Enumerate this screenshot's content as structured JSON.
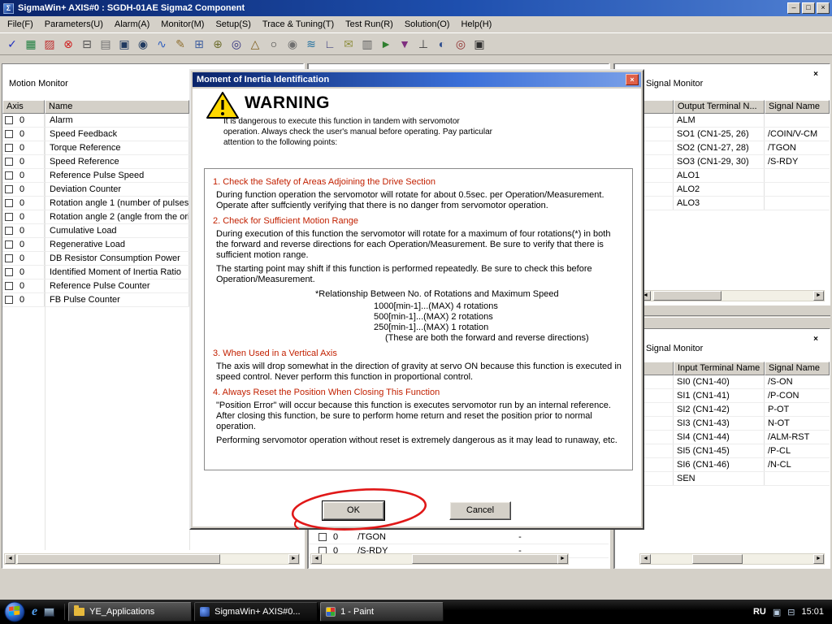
{
  "window": {
    "title": "SigmaWin+ AXIS#0 : SGDH-01AE Sigma2 Component",
    "app_icon_glyph": "Σ",
    "minimize_glyph": "–",
    "restore_glyph": "□",
    "close_glyph": "×"
  },
  "ui": {
    "arrow_left": "◄",
    "arrow_right": "►",
    "close_glyph": "×"
  },
  "colors": {
    "titlebar_blue": "#0a246a",
    "warning_heading_red": "#c22000",
    "annotation_red": "#e01818",
    "classic_gray": "#d4d0c8"
  },
  "menu": {
    "items": [
      {
        "label": "File(F)"
      },
      {
        "label": "Parameters(U)"
      },
      {
        "label": "Alarm(A)"
      },
      {
        "label": "Monitor(M)"
      },
      {
        "label": "Setup(S)"
      },
      {
        "label": "Trace & Tuning(T)"
      },
      {
        "label": "Test Run(R)"
      },
      {
        "label": "Solution(O)"
      },
      {
        "label": "Help(H)"
      }
    ]
  },
  "toolbar": {
    "icons": [
      {
        "name": "check-icon",
        "glyph": "✓",
        "color": "#1f2fbf"
      },
      {
        "name": "parameter-table-icon",
        "glyph": "▦",
        "color": "#1f7f3f"
      },
      {
        "name": "red-graph-icon",
        "glyph": "▨",
        "color": "#bf2f2f"
      },
      {
        "name": "alarm-circle-x-icon",
        "glyph": "⊗",
        "color": "#cf1f1f"
      },
      {
        "name": "printer-icon",
        "glyph": "⊟",
        "color": "#505050"
      },
      {
        "name": "document-icon",
        "glyph": "▤",
        "color": "#707070"
      },
      {
        "name": "monitor-icon",
        "glyph": "▣",
        "color": "#203a60"
      },
      {
        "name": "monitor-graph-icon",
        "glyph": "◉",
        "color": "#203a60"
      },
      {
        "name": "sine-wave-icon",
        "glyph": "∿",
        "color": "#2f5fbf"
      },
      {
        "name": "pencil-chart-icon",
        "glyph": "✎",
        "color": "#8f6f2f"
      },
      {
        "name": "window-grid-icon",
        "glyph": "⊞",
        "color": "#3f5f9f"
      },
      {
        "name": "gears-icon",
        "glyph": "⊕",
        "color": "#6f6f2f"
      },
      {
        "name": "magnifier-graph-icon",
        "glyph": "◎",
        "color": "#2f2f7f"
      },
      {
        "name": "triangle-scale-icon",
        "glyph": "△",
        "color": "#7f5f1f"
      },
      {
        "name": "magnifier-icon",
        "glyph": "○",
        "color": "#404040"
      },
      {
        "name": "gear-icon",
        "glyph": "◉",
        "color": "#6f6f6f"
      },
      {
        "name": "waveform-icon",
        "glyph": "≋",
        "color": "#1f6f9f"
      },
      {
        "name": "xy-plot-icon",
        "glyph": "∟",
        "color": "#404080"
      },
      {
        "name": "envelope-icon",
        "glyph": "✉",
        "color": "#8f8f3f"
      },
      {
        "name": "notepad-icon",
        "glyph": "▥",
        "color": "#5f5f5f"
      },
      {
        "name": "test-run-icon",
        "glyph": "►",
        "color": "#2f7f2f"
      },
      {
        "name": "funnel-icon",
        "glyph": "▼",
        "color": "#7f2f7f"
      },
      {
        "name": "antenna-icon",
        "glyph": "⊥",
        "color": "#3f3f3f"
      },
      {
        "name": "search-chart-icon",
        "glyph": "◐",
        "color": "#2f4f8f"
      },
      {
        "name": "target-icon",
        "glyph": "◎",
        "color": "#8f2f2f"
      },
      {
        "name": "screen-icon",
        "glyph": "▣",
        "color": "#2f2f2f"
      }
    ]
  },
  "panels": {
    "motion": {
      "title": "Motion Monitor",
      "columns": {
        "axis": "Axis",
        "name": "Name"
      },
      "rows": [
        {
          "axis": "0",
          "name": "Alarm"
        },
        {
          "axis": "0",
          "name": "Speed Feedback"
        },
        {
          "axis": "0",
          "name": "Torque Reference"
        },
        {
          "axis": "0",
          "name": "Speed Reference"
        },
        {
          "axis": "0",
          "name": "Reference Pulse Speed"
        },
        {
          "axis": "0",
          "name": "Deviation Counter"
        },
        {
          "axis": "0",
          "name": "Rotation angle 1 (number of pulses"
        },
        {
          "axis": "0",
          "name": "Rotation angle 2 (angle from the ori"
        },
        {
          "axis": "0",
          "name": "Cumulative Load"
        },
        {
          "axis": "0",
          "name": "Regenerative Load"
        },
        {
          "axis": "0",
          "name": "DB Resistor Consumption Power"
        },
        {
          "axis": "0",
          "name": "Identified Moment of Inertia Ratio"
        },
        {
          "axis": "0",
          "name": "Reference Pulse Counter"
        },
        {
          "axis": "0",
          "name": "FB Pulse Counter"
        }
      ]
    },
    "output_signal": {
      "title": "Signal Monitor",
      "columns": {
        "terminal": "Output Terminal N...",
        "signal": "Signal Name"
      },
      "rows": [
        {
          "terminal": "ALM",
          "signal": ""
        },
        {
          "terminal": "SO1 (CN1-25, 26)",
          "signal": "/COIN/V-CM"
        },
        {
          "terminal": "SO2 (CN1-27, 28)",
          "signal": "/TGON"
        },
        {
          "terminal": "SO3 (CN1-29, 30)",
          "signal": "/S-RDY"
        },
        {
          "terminal": "ALO1",
          "signal": ""
        },
        {
          "terminal": "ALO2",
          "signal": ""
        },
        {
          "terminal": "ALO3",
          "signal": ""
        }
      ]
    },
    "input_signal": {
      "title": "Signal Monitor",
      "columns": {
        "terminal": "Input Terminal Name",
        "signal": "Signal Name"
      },
      "rows": [
        {
          "terminal": "SI0 (CN1-40)",
          "signal": "/S-ON"
        },
        {
          "terminal": "SI1 (CN1-41)",
          "signal": "/P-CON"
        },
        {
          "terminal": "SI2 (CN1-42)",
          "signal": "P-OT"
        },
        {
          "terminal": "SI3 (CN1-43)",
          "signal": "N-OT"
        },
        {
          "terminal": "SI4 (CN1-44)",
          "signal": "/ALM-RST"
        },
        {
          "terminal": "SI5 (CN1-45)",
          "signal": "/P-CL"
        },
        {
          "terminal": "SI6 (CN1-46)",
          "signal": "/N-CL"
        },
        {
          "terminal": "SEN",
          "signal": ""
        }
      ]
    },
    "hidden_monitor": {
      "rows": [
        {
          "axis": "0",
          "name": "/TGON",
          "value": "-"
        },
        {
          "axis": "0",
          "name": "/S-RDY",
          "value": "-"
        }
      ]
    }
  },
  "dialog": {
    "title": "Moment of Inertia Identification",
    "close_glyph": "×",
    "warning_title": "WARNING",
    "intro": "It is dangerous to execute this function in tandem with servomotor operation. Always check the user's manual before operating. Pay particular attention to the following points:",
    "sections": [
      {
        "heading": "1. Check the Safety of Areas Adjoining the Drive Section",
        "paragraphs": [
          "During function operation the servomotor will rotate for about 0.5sec. per Operation/Measurement. Operate after suffciently verifying that there is no danger from servomotor operation."
        ]
      },
      {
        "heading": "2. Check for Sufficient Motion Range",
        "paragraphs": [
          "During execution of this function the servomotor will rotate for a maximum of four rotations(*) in both the forward and reverse directions for each Operation/Measurement. Be sure to verify that there is sufficient motion range.",
          "The starting point may shift if this function is performed repeatedly.  Be sure to check this before Operation/Measurement."
        ],
        "note": "*Relationship Between No. of Rotations and Maximum Speed",
        "list": [
          "1000[min-1]...(MAX) 4 rotations",
          "500[min-1]...(MAX) 2 rotations",
          "250[min-1]...(MAX) 1 rotation",
          "(These are both the forward and reverse directions)"
        ]
      },
      {
        "heading": "3. When Used in a Vertical Axis",
        "paragraphs": [
          "The axis will drop somewhat in the direction of gravity at servo ON because this function is executed in speed control. Never perform this function in proportional control."
        ]
      },
      {
        "heading": "4. Always Reset the Position When Closing This Function",
        "paragraphs": [
          "\"Position Error\" will occur because this function is executes servomotor run by an internal reference. After closing this function, be sure to perform home return and reset the position prior to normal operation.",
          "Performing servomotor operation without reset is extremely dangerous as it may lead to runaway, etc."
        ]
      }
    ],
    "ok_label": "OK",
    "cancel_label": "Cancel"
  },
  "taskbar": {
    "tasks": [
      {
        "label": "YE_Applications",
        "icon": "folder"
      },
      {
        "label": "SigmaWin+ AXIS#0...",
        "icon": "sigmawin",
        "active": true
      },
      {
        "label": "1 - Paint",
        "icon": "paint"
      }
    ],
    "tray": {
      "language": "RU",
      "icons": [
        {
          "name": "tray-display-icon",
          "glyph": "▣"
        },
        {
          "name": "tray-device-icon",
          "glyph": "⊟"
        }
      ],
      "time": "15:01"
    }
  }
}
